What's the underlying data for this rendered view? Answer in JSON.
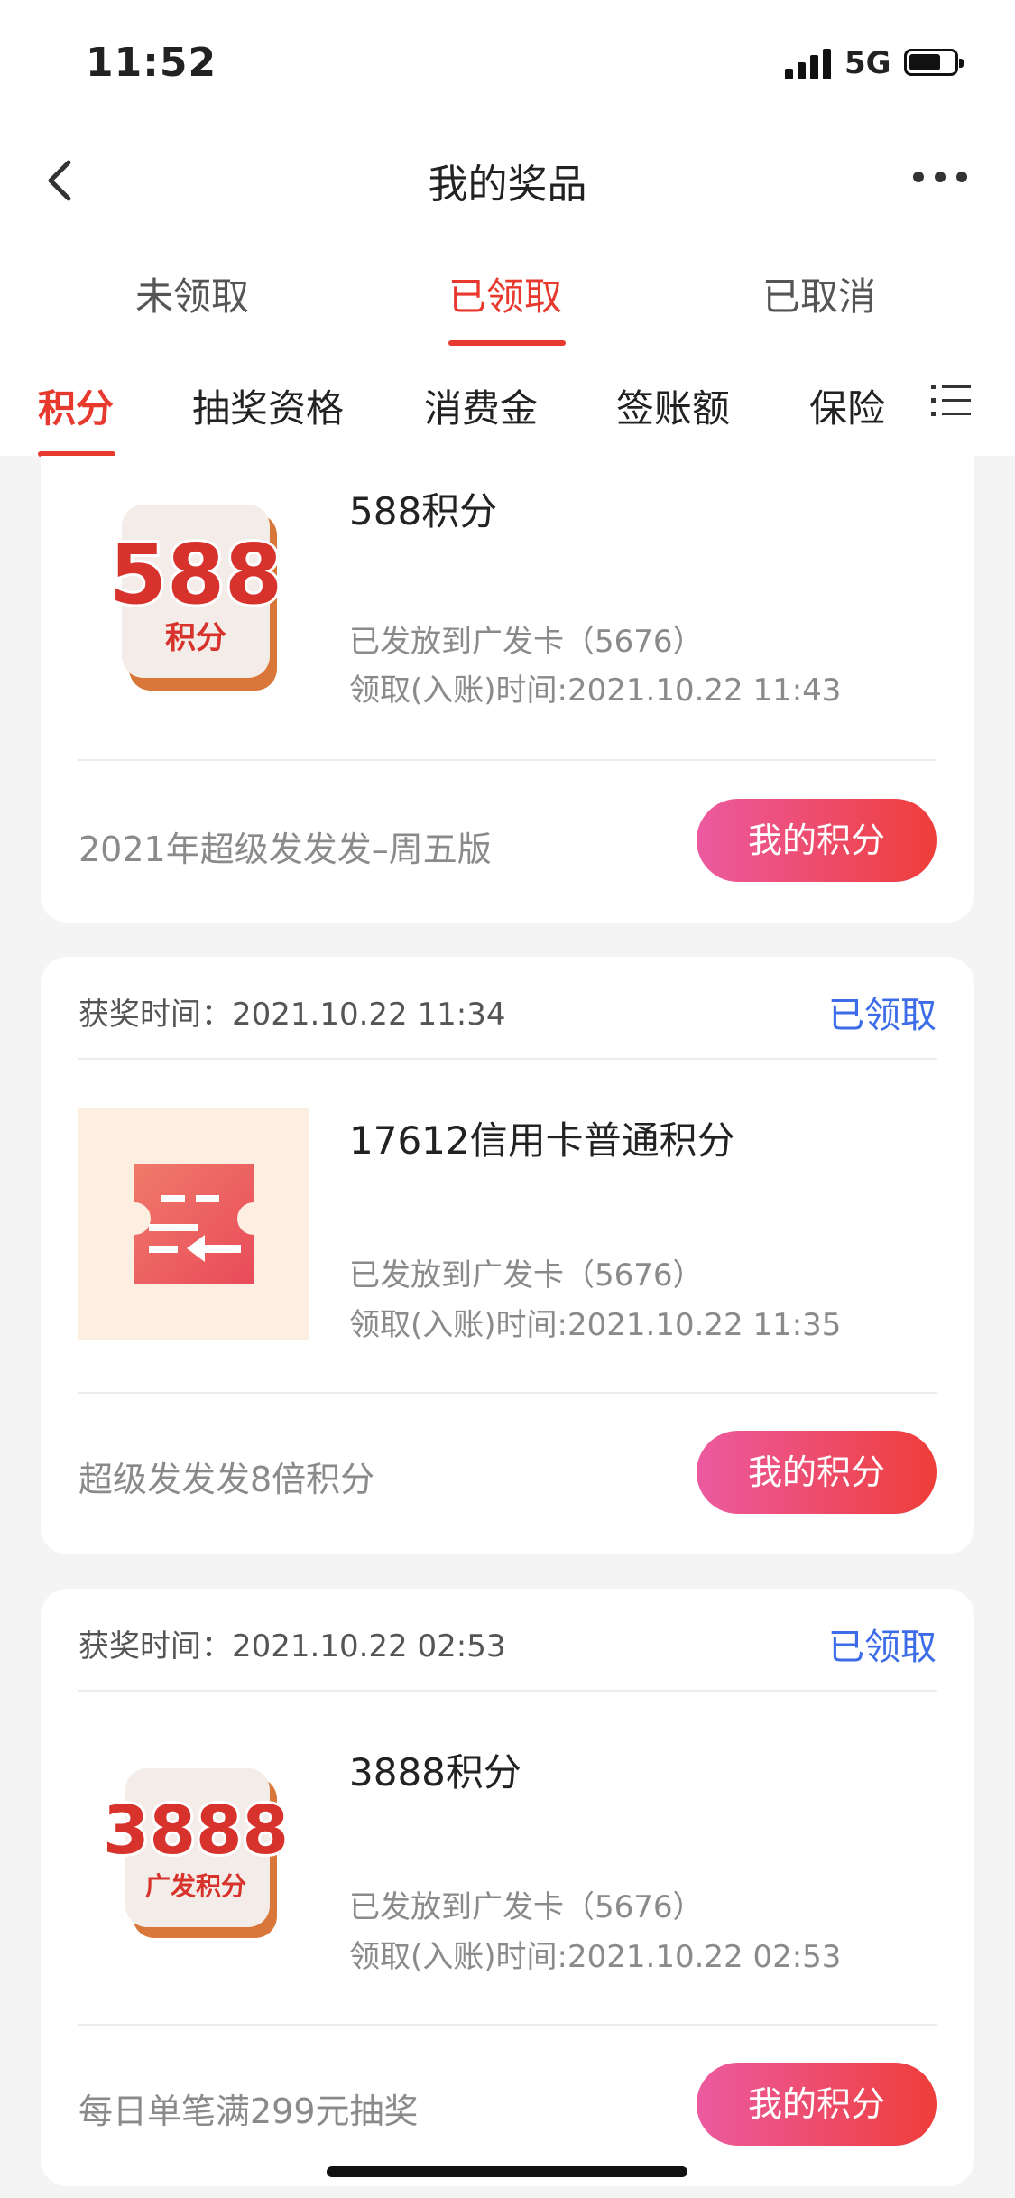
{
  "status_bar": {
    "time": "11:52",
    "network": "5G"
  },
  "nav": {
    "title": "我的奖品"
  },
  "status_tabs": [
    {
      "label": "未领取",
      "active": false
    },
    {
      "label": "已领取",
      "active": true
    },
    {
      "label": "已取消",
      "active": false
    }
  ],
  "category_tabs": [
    {
      "label": "积分",
      "active": true
    },
    {
      "label": "抽奖资格",
      "active": false
    },
    {
      "label": "消费金",
      "active": false
    },
    {
      "label": "签账额",
      "active": false
    },
    {
      "label": "保险",
      "active": false
    }
  ],
  "cards": [
    {
      "image_main": "588",
      "image_sub": "积分",
      "prize_name": "588积分",
      "issued": "已发放到广发卡（5676）",
      "received": "领取(入账)时间:2021.10.22 11:43",
      "activity": "2021年超级发发发–周五版",
      "button": "我的积分"
    },
    {
      "win_time": "获奖时间：2021.10.22 11:34",
      "status": "已领取",
      "prize_name": "17612信用卡普通积分",
      "issued": "已发放到广发卡（5676）",
      "received": "领取(入账)时间:2021.10.22 11:35",
      "activity": "超级发发发8倍积分",
      "button": "我的积分"
    },
    {
      "win_time": "获奖时间：2021.10.22 02:53",
      "status": "已领取",
      "image_main": "3888",
      "image_sub": "广发积分",
      "prize_name": "3888积分",
      "issued": "已发放到广发卡（5676）",
      "received": "领取(入账)时间:2021.10.22 02:53",
      "activity": "每日单笔满299元抽奖",
      "button": "我的积分"
    }
  ],
  "colors": {
    "accent": "#e8392e",
    "status_blue": "#3d6ce8",
    "button_start": "#ec5aa0",
    "button_end": "#ee3e3a"
  }
}
